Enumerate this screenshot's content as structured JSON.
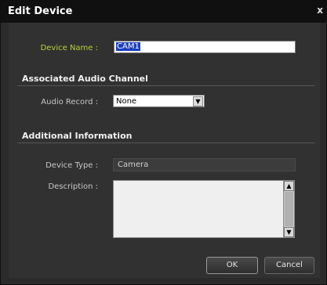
{
  "dialog": {
    "title": "Edit Device",
    "close_glyph": "x"
  },
  "device_name": {
    "label": "Device Name :",
    "value": "CAM1"
  },
  "audio_section": {
    "heading": "Associated Audio Channel",
    "record_label": "Audio Record :",
    "record_value": "None"
  },
  "info_section": {
    "heading": "Additional Information",
    "type_label": "Device Type :",
    "type_value": "Camera",
    "description_label": "Description :",
    "description_value": ""
  },
  "buttons": {
    "ok": "OK",
    "cancel": "Cancel"
  },
  "colors": {
    "accent_label": "#b4d23a",
    "selection": "#1a3fbd"
  }
}
